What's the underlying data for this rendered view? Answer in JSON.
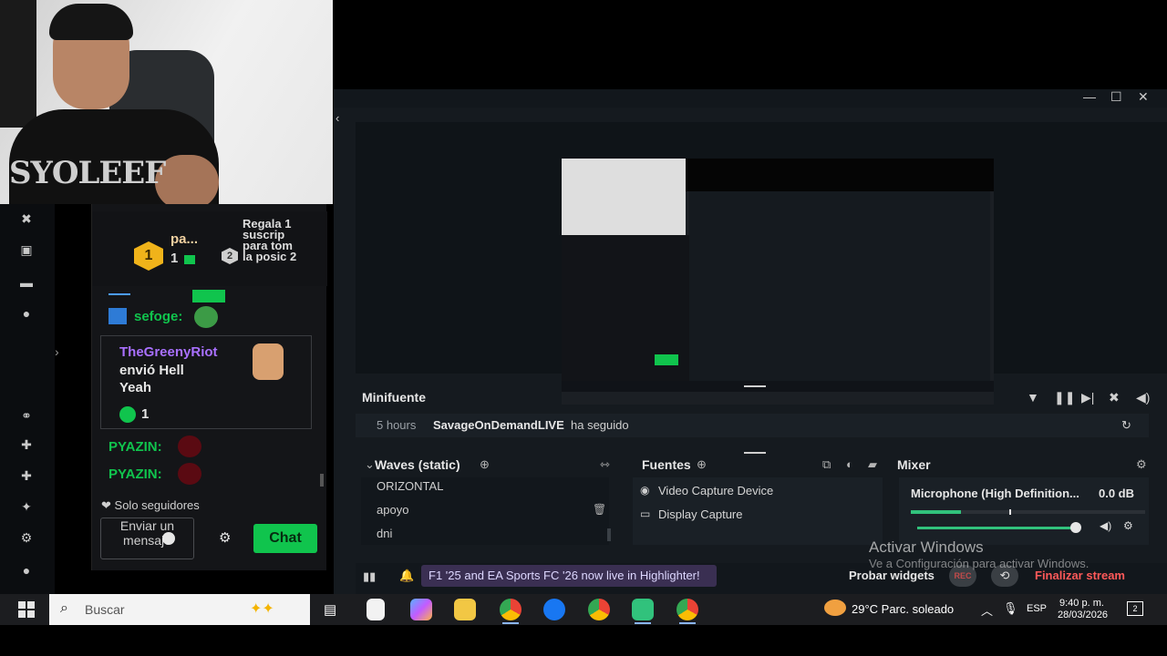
{
  "webcam": {
    "shirt_text": "SYOLEEF"
  },
  "chat": {
    "leader_name": "pa...",
    "leader_count": "1",
    "leader_rank": "1",
    "second_rank": "2",
    "gift_prompt": "Regala 1 suscrip para tom la posic 2",
    "user1": "sefoge:",
    "gift_sender": "TheGreenyRiot",
    "gift_line1": "envió Hell",
    "gift_line2": "Yeah",
    "gift_count": "1",
    "user2": "PYAZIN:",
    "user3": "PYAZIN:",
    "followers_only": "Solo seguidores",
    "input_placeholder": "Enviar un mensaje",
    "chat_button": "Chat"
  },
  "app": {
    "minifuente_title": "Minifuente",
    "follow_time": "5 hours",
    "follow_user": "SavageOnDemandLIVE",
    "follow_action": "ha seguido",
    "scenes_title": "Waves (static)",
    "scenes": [
      "ORIZONTAL",
      "apoyo",
      "dni"
    ],
    "sources_title": "Fuentes",
    "sources": [
      "Video Capture Device",
      "Display Capture"
    ],
    "mixer_title": "Mixer",
    "mixer_source": "Microphone (High Definition...",
    "mixer_db": "0.0 dB",
    "highlighter_text": "F1 '25 and EA Sports FC '26 now live in Highlighter!",
    "probar_widgets": "Probar widgets",
    "rec_label": "REC",
    "end_stream": "Finalizar stream"
  },
  "activate": {
    "line1": "Activar Windows",
    "line2": "Ve a Configuración para activar Windows."
  },
  "taskbar": {
    "search_label": "Buscar",
    "weather": "29°C  Parc. soleado",
    "lang": "ESP",
    "time": "9:40 p. m.",
    "date": "28/03/2026",
    "notifications": "2"
  },
  "colors": {
    "accent_green": "#10c44d",
    "end_stream_red": "#ff5959",
    "gold_badge": "#f0b31a",
    "gift_name_purple": "#a970ff"
  }
}
